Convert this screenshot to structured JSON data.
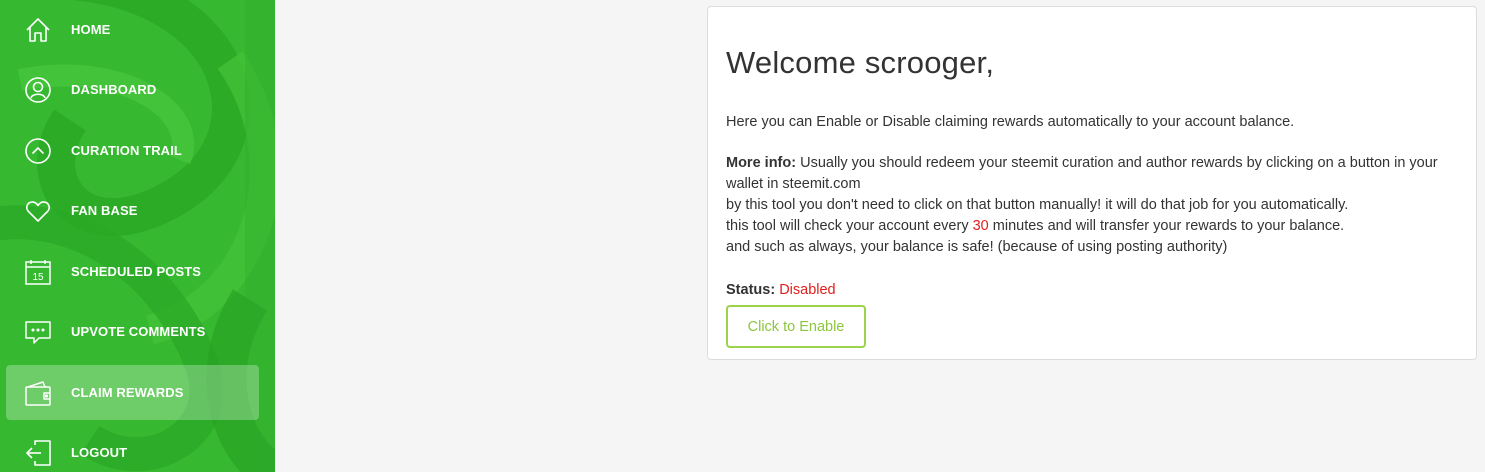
{
  "sidebar": {
    "items": [
      {
        "label": "HOME",
        "icon": "home-icon"
      },
      {
        "label": "DASHBOARD",
        "icon": "user-icon"
      },
      {
        "label": "CURATION TRAIL",
        "icon": "chevron-up-icon"
      },
      {
        "label": "FAN BASE",
        "icon": "heart-icon"
      },
      {
        "label": "SCHEDULED POSTS",
        "icon": "calendar-icon",
        "icon_text": "15"
      },
      {
        "label": "UPVOTE COMMENTS",
        "icon": "comment-icon"
      },
      {
        "label": "CLAIM REWARDS",
        "icon": "wallet-icon",
        "active": true
      },
      {
        "label": "LOGOUT",
        "icon": "logout-icon"
      }
    ]
  },
  "main": {
    "welcome": "Welcome scrooger,",
    "intro": "Here you can Enable or Disable claiming rewards automatically to your account balance.",
    "more_info_label": "More info:",
    "more_info_line1": " Usually you should redeem your steemit curation and author rewards by clicking on a button in your wallet in steemit.com",
    "more_info_line2": "by this tool you don't need to click on that button manually! it will do that job for you automatically.",
    "more_info_line3_pre": "this tool will check your account every ",
    "more_info_line3_num": "30",
    "more_info_line3_post": " minutes and will transfer your rewards to your balance.",
    "more_info_line4": "and such as always, your balance is safe! (because of using posting authority)",
    "status_label": "Status:",
    "status_value": "Disabled",
    "enable_button": "Click to Enable"
  },
  "colors": {
    "sidebar_green": "#35b92f",
    "status_red": "#e0201d",
    "button_green": "#8cc63f"
  }
}
